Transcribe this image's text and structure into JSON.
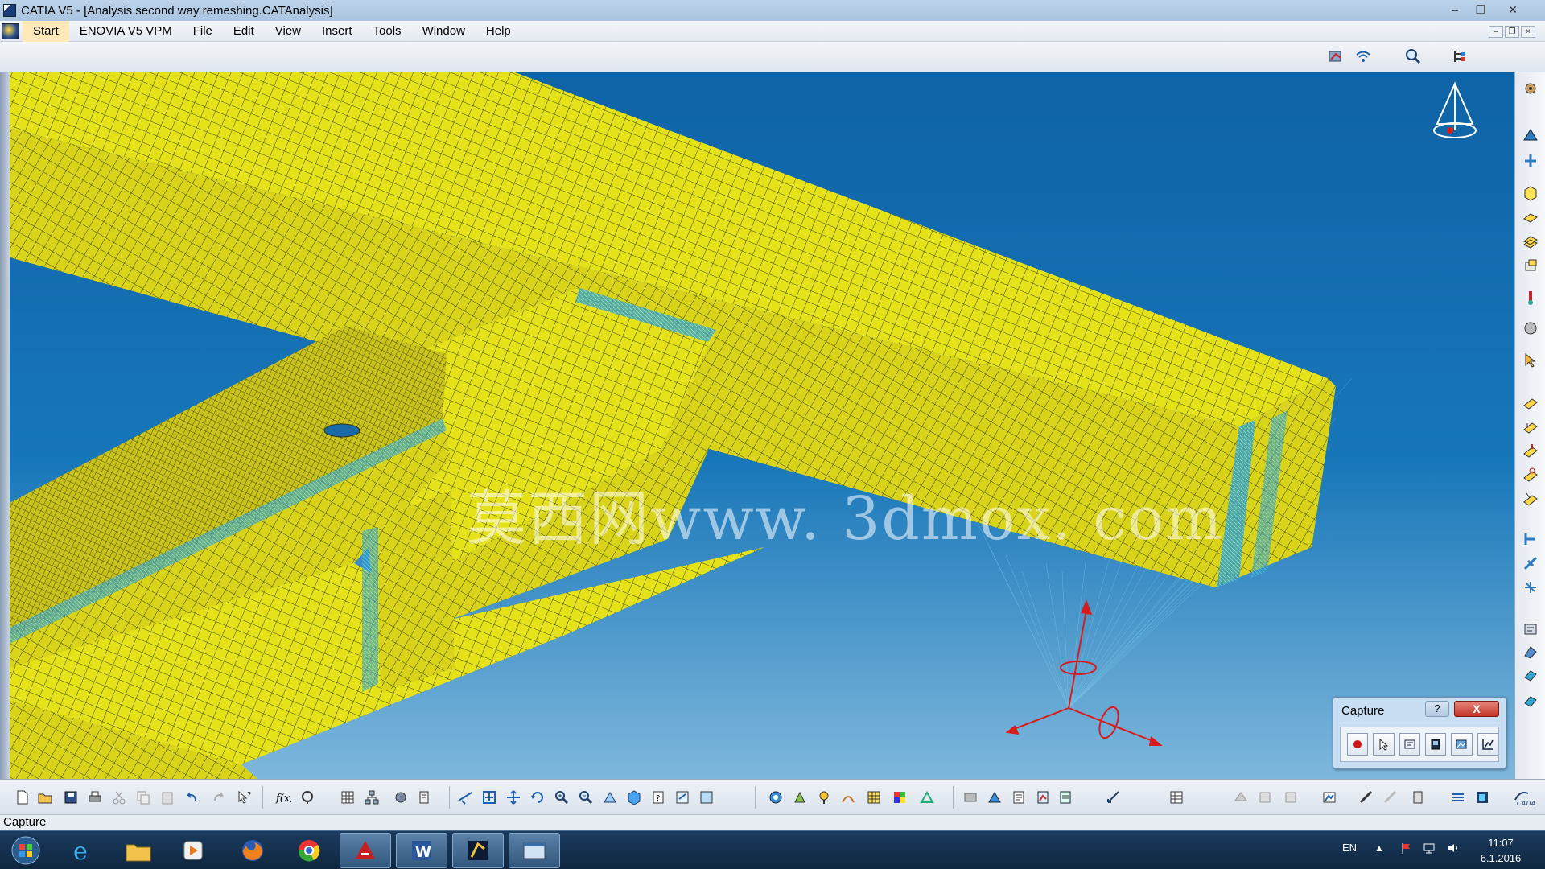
{
  "window": {
    "title": "CATIA V5 - [Analysis second way remeshing.CATAnalysis]",
    "controls": {
      "minimize": "‒",
      "maximize": "❐",
      "close": "✕"
    }
  },
  "menubar": {
    "items": [
      "Start",
      "ENOVIA V5 VPM",
      "File",
      "Edit",
      "View",
      "Insert",
      "Tools",
      "Window",
      "Help"
    ]
  },
  "viewport": {
    "watermark": "莫西网www. 3dmox. com",
    "colors": {
      "mesh_fill": "#e6e21a",
      "mesh_line": "#2e3b1a",
      "background_top": "#0e63a6",
      "background_bottom": "#7eb7dc",
      "axis": "#d81c1c"
    }
  },
  "capture_dialog": {
    "title": "Capture",
    "help": "?",
    "close": "X",
    "tools": [
      "record-icon",
      "select-icon",
      "options-icon",
      "album-icon",
      "capture-image-icon",
      "graph-icon"
    ]
  },
  "statusbar": {
    "text": "Capture"
  },
  "taskbar": {
    "language": "EN",
    "time": "11:07",
    "date": "6.1.2016"
  }
}
